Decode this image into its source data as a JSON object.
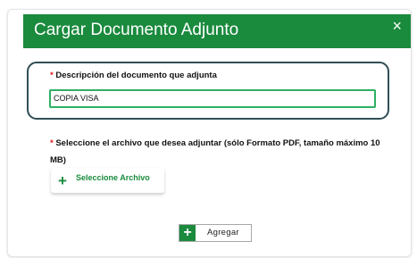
{
  "dialog": {
    "title": "Cargar Documento Adjunto",
    "close_icon": "×"
  },
  "description": {
    "required_mark": "*",
    "label": "Descripción del documento que adjunta",
    "value": "COPIA VISA"
  },
  "file": {
    "required_mark": "*",
    "label_line1": "Seleccione el archivo que desea adjuntar (sólo Formato PDF, tamaño máximo 10",
    "label_line2": "MB)",
    "button_icon": "+",
    "button_label": "Seleccione Archivo"
  },
  "actions": {
    "add_icon": "+",
    "add_label": "Agregar"
  },
  "colors": {
    "header": "#1a8a3d",
    "required": "#e0151b",
    "input_border": "#2fb063",
    "highlight_border": "#2f4f56"
  }
}
